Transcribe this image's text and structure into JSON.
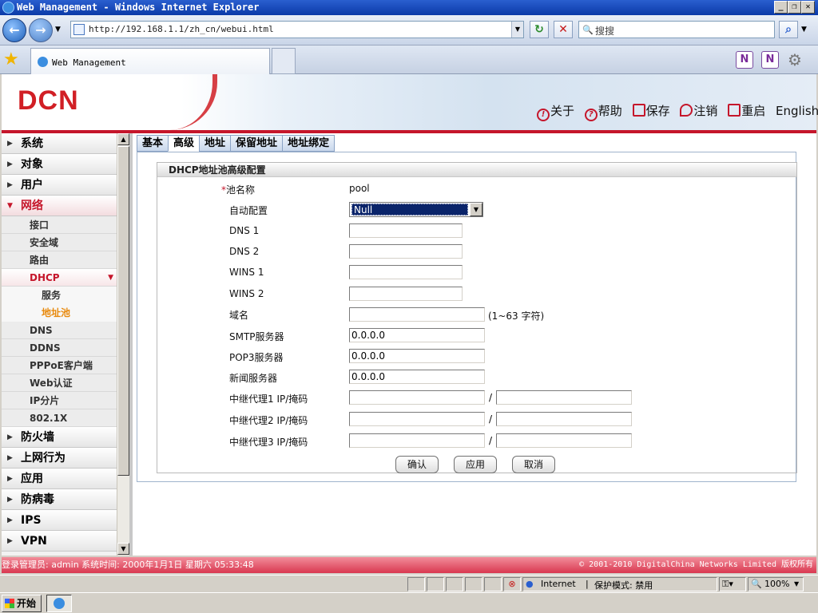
{
  "browser": {
    "window_title": "Web Management - Windows Internet Explorer",
    "url": "http://192.168.1.1/zh_cn/webui.html",
    "search_placeholder": "搜搜",
    "tab_title": "Web Management",
    "zone": "Internet",
    "protected_mode": "保护模式: 禁用",
    "zoom": "100%",
    "start_label": "开始"
  },
  "header": {
    "logo": "DCN",
    "links": {
      "about": "关于",
      "help": "帮助",
      "save": "保存",
      "logout": "注销",
      "reboot": "重启",
      "english": "English"
    }
  },
  "sidebar": {
    "items": [
      {
        "label": "系统"
      },
      {
        "label": "对象"
      },
      {
        "label": "用户"
      },
      {
        "label": "网络"
      }
    ],
    "network_sub": [
      "接口",
      "安全域",
      "路由",
      "DHCP"
    ],
    "dhcp_sub": [
      "服务",
      "地址池"
    ],
    "network_sub2": [
      "DNS",
      "DDNS",
      "PPPoE客户端",
      "Web认证",
      "IP分片",
      "802.1X"
    ],
    "items_after": [
      {
        "label": "防火墙"
      },
      {
        "label": "上网行为"
      },
      {
        "label": "应用"
      },
      {
        "label": "防病毒"
      },
      {
        "label": "IPS"
      },
      {
        "label": "VPN"
      }
    ]
  },
  "tabs": [
    "基本",
    "高级",
    "地址",
    "保留地址",
    "地址绑定"
  ],
  "form": {
    "title": "DHCP地址池高级配置",
    "pool_name_label": "池名称",
    "pool_name_required": "*",
    "pool_name_value": "pool",
    "auto_config_label": "自动配置",
    "auto_config_value": "Null",
    "dns1_label": "DNS 1",
    "dns2_label": "DNS 2",
    "wins1_label": "WINS 1",
    "wins2_label": "WINS 2",
    "domain_label": "域名",
    "domain_hint": "(1~63 字符)",
    "smtp_label": "SMTP服务器",
    "smtp_value": "0.0.0.0",
    "pop3_label": "POP3服务器",
    "pop3_value": "0.0.0.0",
    "news_label": "新闻服务器",
    "news_value": "0.0.0.0",
    "relay1_label": "中继代理1 IP/掩码",
    "relay2_label": "中继代理2 IP/掩码",
    "relay3_label": "中继代理3 IP/掩码",
    "slash": "/",
    "ok_label": "确认",
    "apply_label": "应用",
    "cancel_label": "取消"
  },
  "status": {
    "left": "登录管理员: admin 系统时间: 2000年1月1日 星期六 05:33:48",
    "right": "© 2001-2010 DigitalChina Networks Limited 版权所有"
  },
  "colors": {
    "accent": "#c5162b",
    "active_sub": "#e8890c"
  }
}
